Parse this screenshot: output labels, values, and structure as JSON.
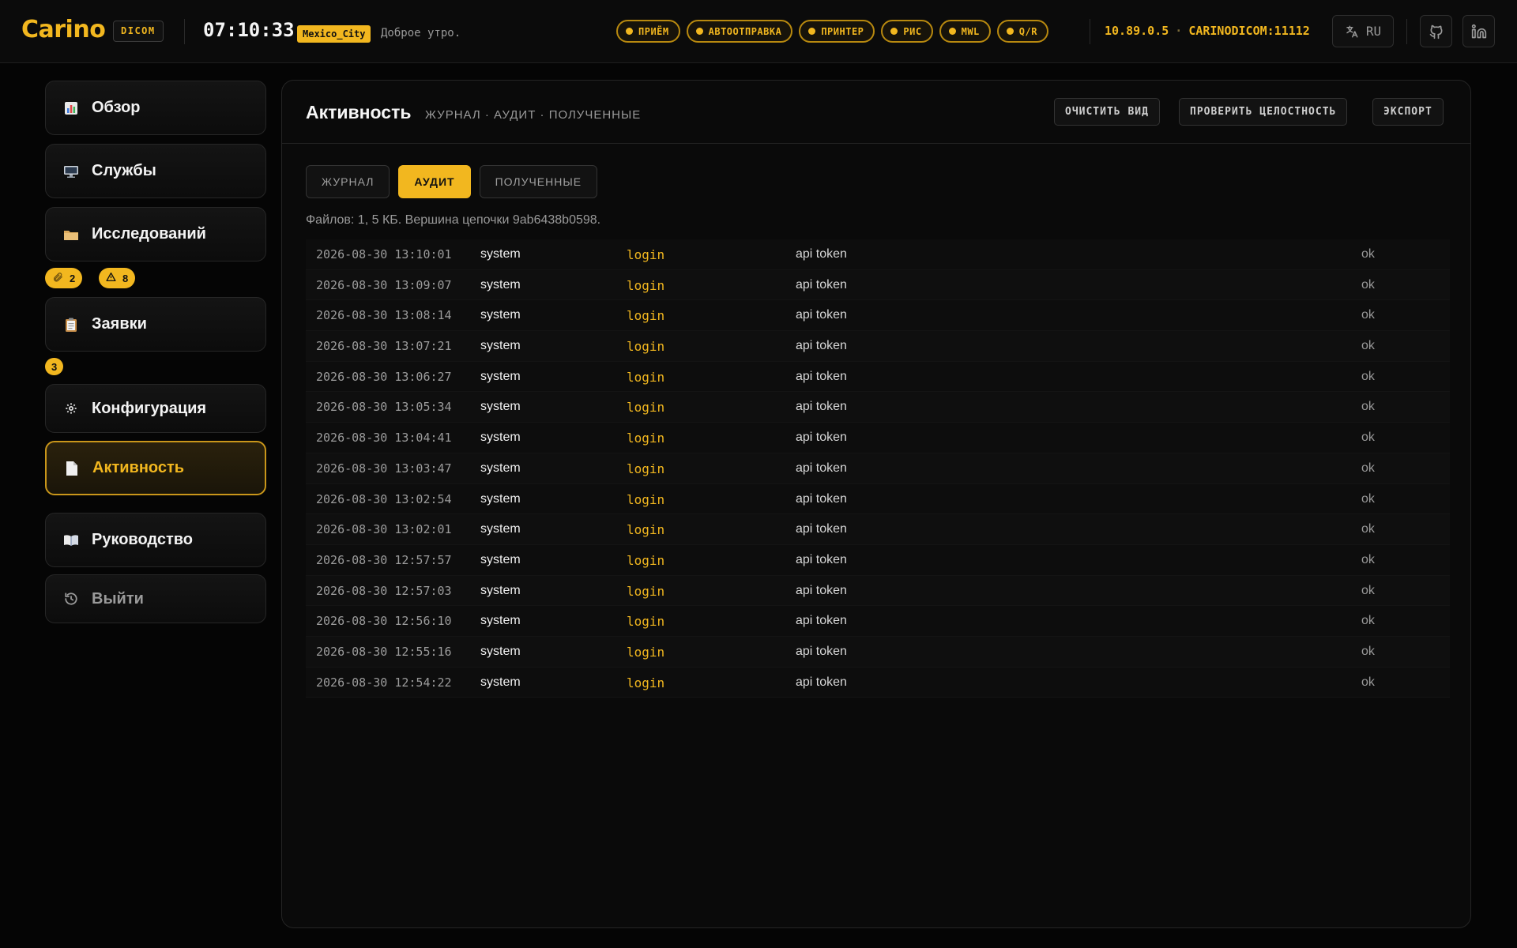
{
  "header": {
    "logo": "Carino",
    "logo_tag": "DICOM",
    "clock": "07:10:33",
    "timezone": "Mexico_City",
    "greeting": "Доброе утро.",
    "services": [
      "ПРИЁМ",
      "АВТООТПРАВКА",
      "ПРИНТЕР",
      "РИС",
      "MWL",
      "Q/R"
    ],
    "host_ip": "10.89.0.5",
    "host_separator": "·",
    "host_ae": "CARINODICOM:11112",
    "language": "RU"
  },
  "sidebar": {
    "items": [
      {
        "label": "Обзор",
        "icon": "bar-chart-icon"
      },
      {
        "label": "Службы",
        "icon": "monitor-icon"
      },
      {
        "label": "Исследований",
        "icon": "folder-icon"
      },
      {
        "label": "Заявки",
        "icon": "clipboard-icon"
      },
      {
        "label": "Конфигурация",
        "icon": "gear-icon"
      },
      {
        "label": "Активность",
        "icon": "document-icon"
      },
      {
        "label": "Руководство",
        "icon": "book-icon"
      },
      {
        "label": "Выйти",
        "icon": "logout-icon"
      }
    ],
    "badges": {
      "studies_link_count": "2",
      "studies_warning_count": "8",
      "orders_count": "3"
    }
  },
  "panel": {
    "title": "Активность",
    "subtitle": "ЖУРНАЛ · АУДИТ · ПОЛУЧЕННЫЕ",
    "actions": {
      "clear": "ОЧИСТИТЬ ВИД",
      "verify": "ПРОВЕРИТЬ ЦЕЛОСТНОСТЬ",
      "export": "ЭКСПОРТ"
    },
    "tabs": [
      "ЖУРНАЛ",
      "АУДИТ",
      "ПОЛУЧЕННЫЕ"
    ],
    "active_tab": "АУДИТ",
    "summary": "Файлов: 1, 5 КБ. Вершина цепочки 9ab6438b0598."
  },
  "audit_rows": [
    {
      "time": "2026-08-30 13:10:01",
      "user": "system",
      "action": "login",
      "detail": "api token",
      "result": "ok"
    },
    {
      "time": "2026-08-30 13:09:07",
      "user": "system",
      "action": "login",
      "detail": "api token",
      "result": "ok"
    },
    {
      "time": "2026-08-30 13:08:14",
      "user": "system",
      "action": "login",
      "detail": "api token",
      "result": "ok"
    },
    {
      "time": "2026-08-30 13:07:21",
      "user": "system",
      "action": "login",
      "detail": "api token",
      "result": "ok"
    },
    {
      "time": "2026-08-30 13:06:27",
      "user": "system",
      "action": "login",
      "detail": "api token",
      "result": "ok"
    },
    {
      "time": "2026-08-30 13:05:34",
      "user": "system",
      "action": "login",
      "detail": "api token",
      "result": "ok"
    },
    {
      "time": "2026-08-30 13:04:41",
      "user": "system",
      "action": "login",
      "detail": "api token",
      "result": "ok"
    },
    {
      "time": "2026-08-30 13:03:47",
      "user": "system",
      "action": "login",
      "detail": "api token",
      "result": "ok"
    },
    {
      "time": "2026-08-30 13:02:54",
      "user": "system",
      "action": "login",
      "detail": "api token",
      "result": "ok"
    },
    {
      "time": "2026-08-30 13:02:01",
      "user": "system",
      "action": "login",
      "detail": "api token",
      "result": "ok"
    },
    {
      "time": "2026-08-30 12:57:57",
      "user": "system",
      "action": "login",
      "detail": "api token",
      "result": "ok"
    },
    {
      "time": "2026-08-30 12:57:03",
      "user": "system",
      "action": "login",
      "detail": "api token",
      "result": "ok"
    },
    {
      "time": "2026-08-30 12:56:10",
      "user": "system",
      "action": "login",
      "detail": "api token",
      "result": "ok"
    },
    {
      "time": "2026-08-30 12:55:16",
      "user": "system",
      "action": "login",
      "detail": "api token",
      "result": "ok"
    },
    {
      "time": "2026-08-30 12:54:22",
      "user": "system",
      "action": "login",
      "detail": "api token",
      "result": "ok"
    }
  ],
  "colors": {
    "accent": "#f2b71f",
    "background": "#050505",
    "panel": "#0a0a0a"
  }
}
